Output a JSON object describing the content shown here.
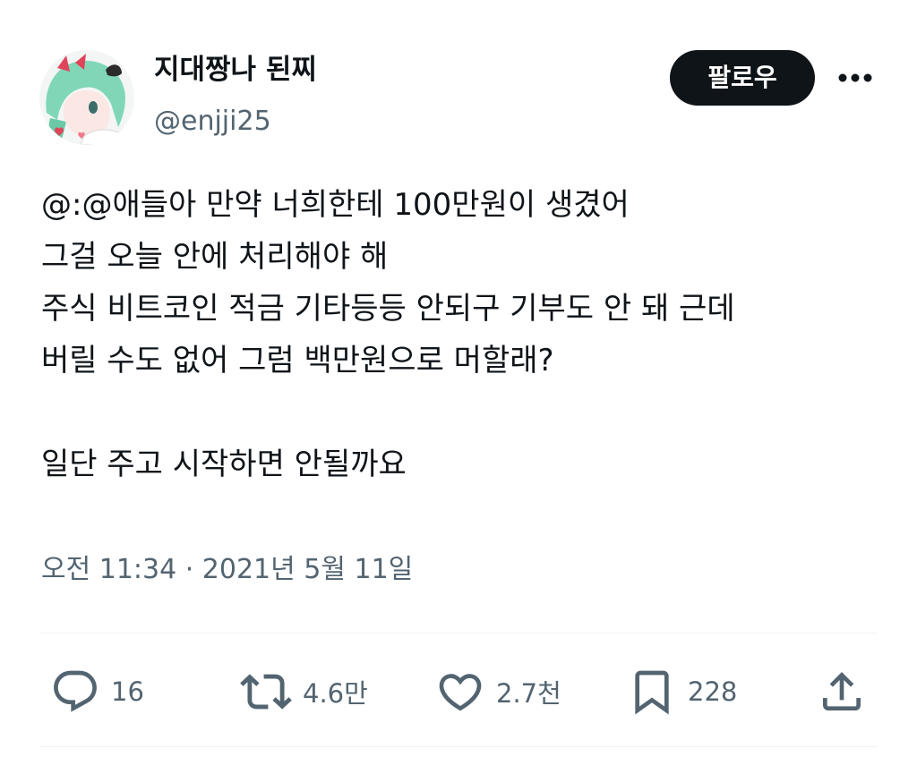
{
  "user": {
    "display_name": "지대짱나 된찌",
    "handle": "@enjji25",
    "avatar_icon": "anime-avatar"
  },
  "header": {
    "follow_label": "팔로우",
    "more_icon": "more-horizontal-icon"
  },
  "tweet": {
    "lines": [
      "@:@애들아 만약 너희한테 100만원이 생겼어",
      "그걸 오늘 안에 처리해야 해",
      "주식 비트코인 적금 기타등등 안되구 기부도 안 돼 근데",
      "버릴 수도 없어 그럼 백만원으로 머할래?",
      "",
      "일단 주고 시작하면 안될까요"
    ],
    "timestamp": "오전 11:34 · 2021년 5월 11일"
  },
  "actions": {
    "reply": {
      "icon": "reply-icon",
      "count": "16"
    },
    "retweet": {
      "icon": "retweet-icon",
      "count": "4.6만"
    },
    "like": {
      "icon": "heart-icon",
      "count": "2.7천"
    },
    "bookmark": {
      "icon": "bookmark-icon",
      "count": "228"
    },
    "share": {
      "icon": "share-icon"
    }
  },
  "colors": {
    "text": "#0f1419",
    "secondary": "#536471",
    "button_bg": "#0f1419",
    "button_text": "#ffffff",
    "divider": "#eff3f4"
  }
}
